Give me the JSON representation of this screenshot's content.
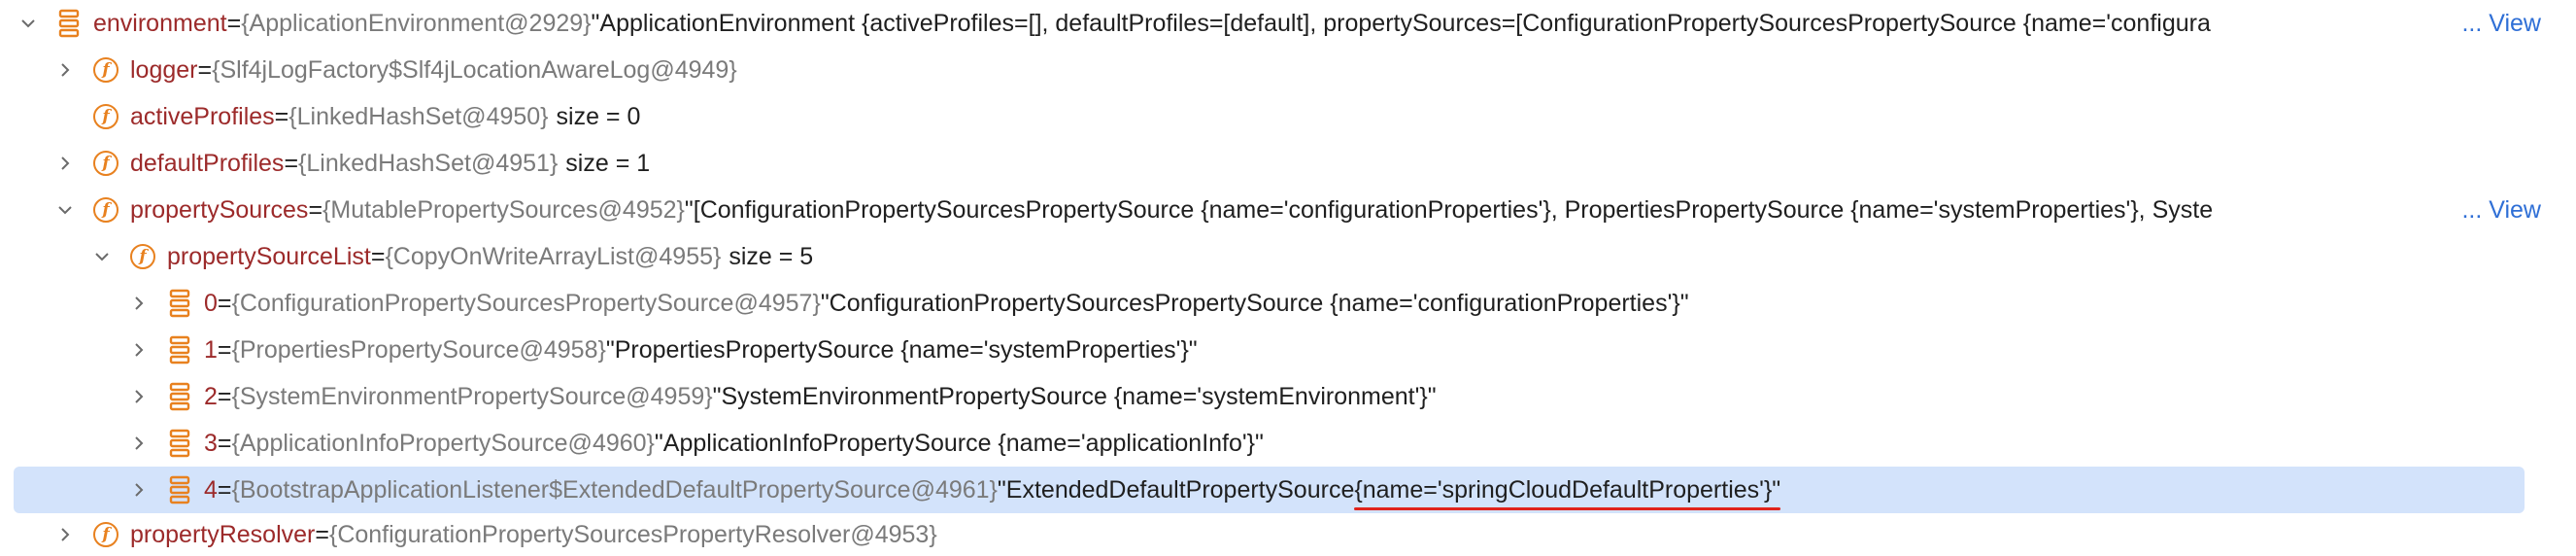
{
  "rows": [
    {
      "name": "environment",
      "eq": " = ",
      "type": "{ApplicationEnvironment@2929}",
      "value": " \"ApplicationEnvironment {activeProfiles=[], defaultProfiles=[default], propertySources=[ConfigurationPropertySourcesPropertySource {name='configura",
      "view": "... View"
    },
    {
      "name": "logger",
      "eq": " = ",
      "type": "{Slf4jLogFactory$Slf4jLocationAwareLog@4949}"
    },
    {
      "name": "activeProfiles",
      "eq": " = ",
      "type": "{LinkedHashSet@4950}",
      "size": "size = 0"
    },
    {
      "name": "defaultProfiles",
      "eq": " = ",
      "type": "{LinkedHashSet@4951}",
      "size": "size = 1"
    },
    {
      "name": "propertySources",
      "eq": " = ",
      "type": "{MutablePropertySources@4952}",
      "value": " \"[ConfigurationPropertySourcesPropertySource {name='configurationProperties'}, PropertiesPropertySource {name='systemProperties'}, Syste",
      "view": "... View"
    },
    {
      "name": "propertySourceList",
      "eq": " = ",
      "type": "{CopyOnWriteArrayList@4955}",
      "size": "size = 5"
    },
    {
      "name": "0",
      "eq": " = ",
      "type": "{ConfigurationPropertySourcesPropertySource@4957}",
      "value": " \"ConfigurationPropertySourcesPropertySource {name='configurationProperties'}\""
    },
    {
      "name": "1",
      "eq": " = ",
      "type": "{PropertiesPropertySource@4958}",
      "value": " \"PropertiesPropertySource {name='systemProperties'}\""
    },
    {
      "name": "2",
      "eq": " = ",
      "type": "{SystemEnvironmentPropertySource@4959}",
      "value": " \"SystemEnvironmentPropertySource {name='systemEnvironment'}\""
    },
    {
      "name": "3",
      "eq": " = ",
      "type": "{ApplicationInfoPropertySource@4960}",
      "value": " \"ApplicationInfoPropertySource {name='applicationInfo'}\""
    },
    {
      "name": "4",
      "eq": " = ",
      "type": "{BootstrapApplicationListener$ExtendedDefaultPropertySource@4961}",
      "value_prefix": " \"ExtendedDefaultPropertySource ",
      "value_highlight": "{name='springCloudDefaultProperties'}\""
    },
    {
      "name": "propertyResolver",
      "eq": " = ",
      "type": "{ConfigurationPropertySourcesPropertyResolver@4953}"
    }
  ],
  "icons": {
    "chevron_right": "chevron-right-icon",
    "chevron_down": "chevron-down-icon",
    "field": "field-icon",
    "array": "array-element-icon",
    "field_letter": "f"
  },
  "colors": {
    "field_name": "#9c2a2a",
    "type": "#7a7a7a",
    "link": "#2f6fd6",
    "icon_orange": "#e8811f",
    "selection": "#d3e3fb",
    "underline": "#e0231c"
  }
}
